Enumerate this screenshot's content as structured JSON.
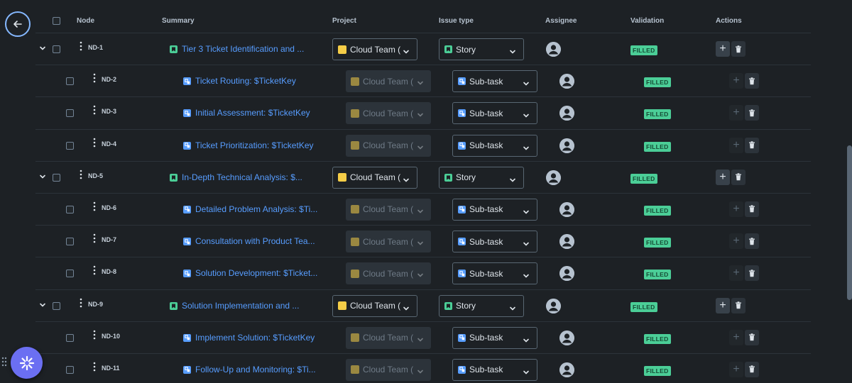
{
  "headers": {
    "node": "Node",
    "summary": "Summary",
    "project": "Project",
    "issue_type": "Issue type",
    "assignee": "Assignee",
    "validation": "Validation",
    "actions": "Actions"
  },
  "rows": [
    {
      "node": "ND-1",
      "summary": "Tier 3 Ticket Identification and ...",
      "project": "Cloud Team (",
      "issue_type": "Story",
      "validation": "FILLED",
      "level": 0
    },
    {
      "node": "ND-2",
      "summary": "Ticket Routing: $TicketKey",
      "project": "Cloud Team (",
      "issue_type": "Sub-task",
      "validation": "FILLED",
      "level": 1
    },
    {
      "node": "ND-3",
      "summary": "Initial Assessment: $TicketKey",
      "project": "Cloud Team (",
      "issue_type": "Sub-task",
      "validation": "FILLED",
      "level": 1
    },
    {
      "node": "ND-4",
      "summary": "Ticket Prioritization: $TicketKey",
      "project": "Cloud Team (",
      "issue_type": "Sub-task",
      "validation": "FILLED",
      "level": 1
    },
    {
      "node": "ND-5",
      "summary": "In-Depth Technical Analysis: $...",
      "project": "Cloud Team (",
      "issue_type": "Story",
      "validation": "FILLED",
      "level": 0
    },
    {
      "node": "ND-6",
      "summary": "Detailed Problem Analysis: $Ti...",
      "project": "Cloud Team (",
      "issue_type": "Sub-task",
      "validation": "FILLED",
      "level": 1
    },
    {
      "node": "ND-7",
      "summary": "Consultation with Product Tea...",
      "project": "Cloud Team (",
      "issue_type": "Sub-task",
      "validation": "FILLED",
      "level": 1
    },
    {
      "node": "ND-8",
      "summary": "Solution Development: $Ticket...",
      "project": "Cloud Team (",
      "issue_type": "Sub-task",
      "validation": "FILLED",
      "level": 1
    },
    {
      "node": "ND-9",
      "summary": "Solution Implementation and ...",
      "project": "Cloud Team (",
      "issue_type": "Story",
      "validation": "FILLED",
      "level": 0
    },
    {
      "node": "ND-10",
      "summary": "Implement Solution: $TicketKey",
      "project": "Cloud Team (",
      "issue_type": "Sub-task",
      "validation": "FILLED",
      "level": 1
    },
    {
      "node": "ND-11",
      "summary": "Follow-Up and Monitoring: $Ti...",
      "project": "Cloud Team (",
      "issue_type": "Sub-task",
      "validation": "FILLED",
      "level": 1
    }
  ],
  "colors": {
    "background": "#1d2125",
    "link": "#579dff",
    "story": "#4bce97",
    "subtask": "#579dff",
    "project": "#f5cd47",
    "badge": "#4bce97",
    "fab": "#6b6ff2"
  }
}
